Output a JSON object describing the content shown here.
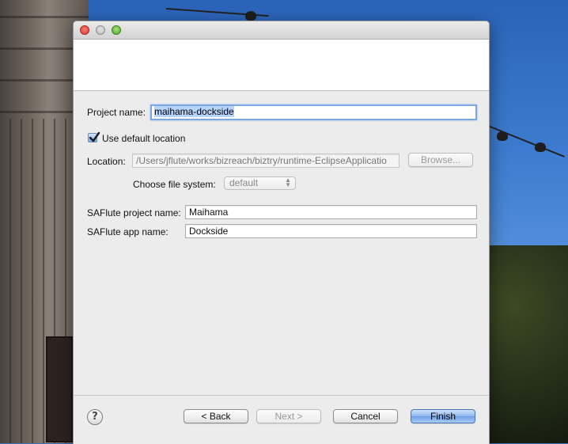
{
  "window": {
    "title": ""
  },
  "form": {
    "project_name_label": "Project name:",
    "project_name_value": "maihama-dockside",
    "use_default_location_label": "Use default location",
    "use_default_location_checked": true,
    "location_label": "Location:",
    "location_value": "/Users/jflute/works/bizreach/biztry/runtime-EclipseApplicatio",
    "browse_label": "Browse...",
    "file_system_label": "Choose file system:",
    "file_system_value": "default",
    "saflute_project_label": "SAFlute project name:",
    "saflute_project_value": "Maihama",
    "saflute_app_label": "SAFlute app name:",
    "saflute_app_value": "Dockside"
  },
  "buttons": {
    "help": "?",
    "back": "< Back",
    "next": "Next >",
    "cancel": "Cancel",
    "finish": "Finish"
  },
  "colors": {
    "accent": "#6e9fe6",
    "selection": "#b5d5ff",
    "dialog_bg": "#ececec"
  },
  "icons": {
    "help": "question-mark-circle-icon",
    "check": "checkmark-icon",
    "popup_arrows": "up-down-arrows-icon"
  }
}
